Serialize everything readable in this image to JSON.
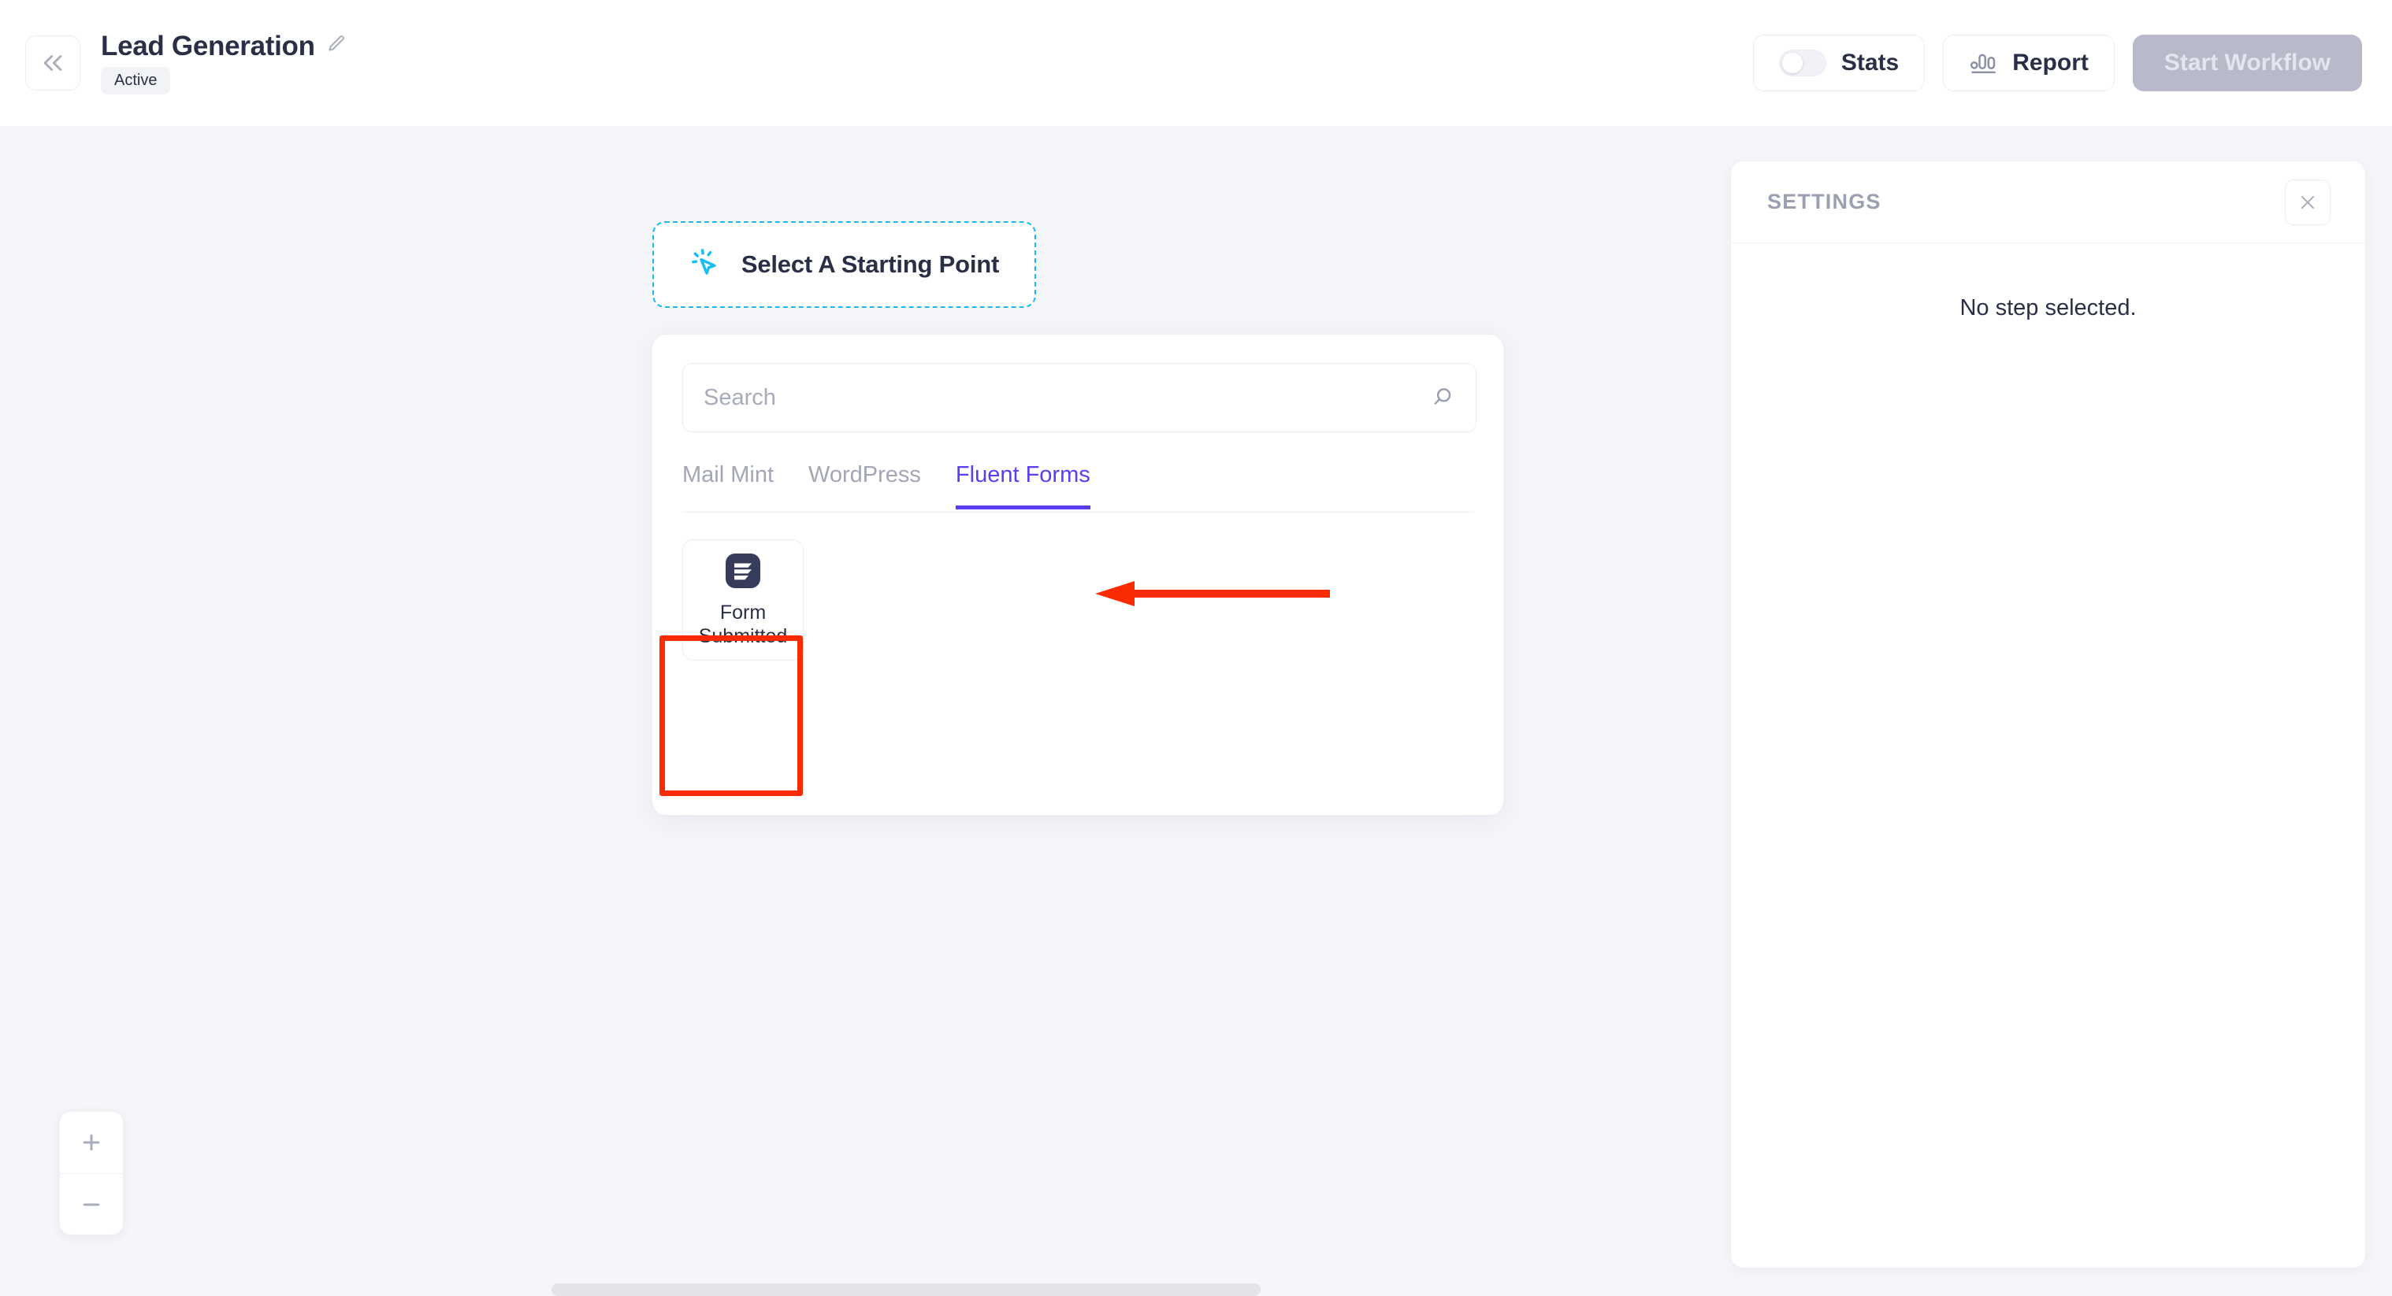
{
  "header": {
    "collapse_icon": "double-chevron-left-icon",
    "workflow_title": "Lead Generation",
    "edit_icon": "pencil-edit-icon",
    "status_badge": "Active",
    "stats_label": "Stats",
    "stats_toggle_state": "off",
    "report_label": "Report",
    "report_icon": "bar-chart-icon",
    "start_workflow_label": "Start Workflow",
    "start_workflow_disabled": true
  },
  "canvas": {
    "start_point": {
      "label": "Select A Starting Point",
      "icon": "cursor-click-icon",
      "border_color": "#1ab9f2"
    },
    "picker": {
      "search": {
        "placeholder": "Search",
        "value": "",
        "icon": "search-icon"
      },
      "tabs": [
        {
          "label": "Mail Mint",
          "active": false
        },
        {
          "label": "WordPress",
          "active": false
        },
        {
          "label": "Fluent Forms",
          "active": true
        }
      ],
      "active_tab_color": "#5b3df5",
      "items": [
        {
          "label": "Form Submitted",
          "icon": "fluent-forms-logo-icon"
        }
      ]
    },
    "annotations": {
      "color": "#fa2b00",
      "highlight_target": "Form Submitted",
      "arrow_target": "Fluent Forms"
    },
    "zoom_in_label": "+",
    "zoom_out_label": "−"
  },
  "settings_panel": {
    "title": "SETTINGS",
    "close_icon": "close-x-icon",
    "empty_message": "No step selected."
  }
}
